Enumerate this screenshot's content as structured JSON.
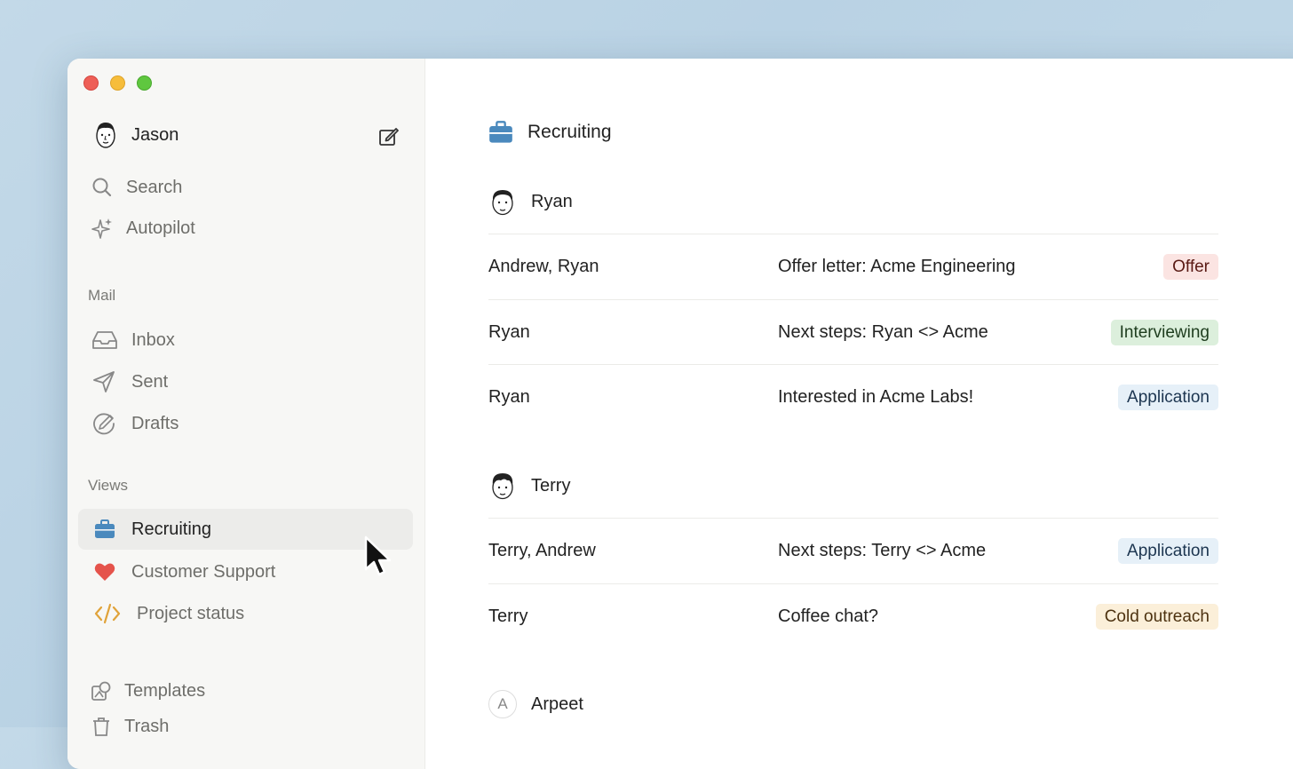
{
  "sidebar": {
    "user": {
      "name": "Jason"
    },
    "search_label": "Search",
    "autopilot_label": "Autopilot",
    "mail_section": "Mail",
    "mail_items": [
      {
        "label": "Inbox",
        "icon": "inbox-icon"
      },
      {
        "label": "Sent",
        "icon": "send-icon"
      },
      {
        "label": "Drafts",
        "icon": "drafts-icon"
      }
    ],
    "views_section": "Views",
    "view_items": [
      {
        "label": "Recruiting",
        "icon": "briefcase-icon",
        "color": "#4a89bd",
        "active": true
      },
      {
        "label": "Customer Support",
        "icon": "heart-icon",
        "color": "#e5534b",
        "active": false
      },
      {
        "label": "Project status",
        "icon": "code-icon",
        "color": "#e0a33a",
        "active": false
      }
    ],
    "templates_label": "Templates",
    "trash_label": "Trash"
  },
  "main": {
    "title": "Recruiting",
    "groups": [
      {
        "person": "Ryan",
        "rows": [
          {
            "from": "Andrew, Ryan",
            "subject": "Offer letter: Acme Engineering",
            "status": "Offer"
          },
          {
            "from": "Ryan",
            "subject": "Next steps: Ryan <> Acme",
            "status": "Interviewing"
          },
          {
            "from": "Ryan",
            "subject": "Interested in Acme Labs!",
            "status": "Application"
          }
        ]
      },
      {
        "person": "Terry",
        "rows": [
          {
            "from": "Terry, Andrew",
            "subject": "Next steps: Terry <> Acme",
            "status": "Application"
          },
          {
            "from": "Terry",
            "subject": "Coffee chat?",
            "status": "Cold outreach"
          }
        ]
      },
      {
        "person": "Arpeet",
        "avatar_letter": "A",
        "rows": []
      }
    ]
  },
  "colors": {
    "offer": "#fbe4e2",
    "interviewing": "#dcefdc",
    "application": "#e6f0f8",
    "cold_outreach": "#fbefd9"
  }
}
